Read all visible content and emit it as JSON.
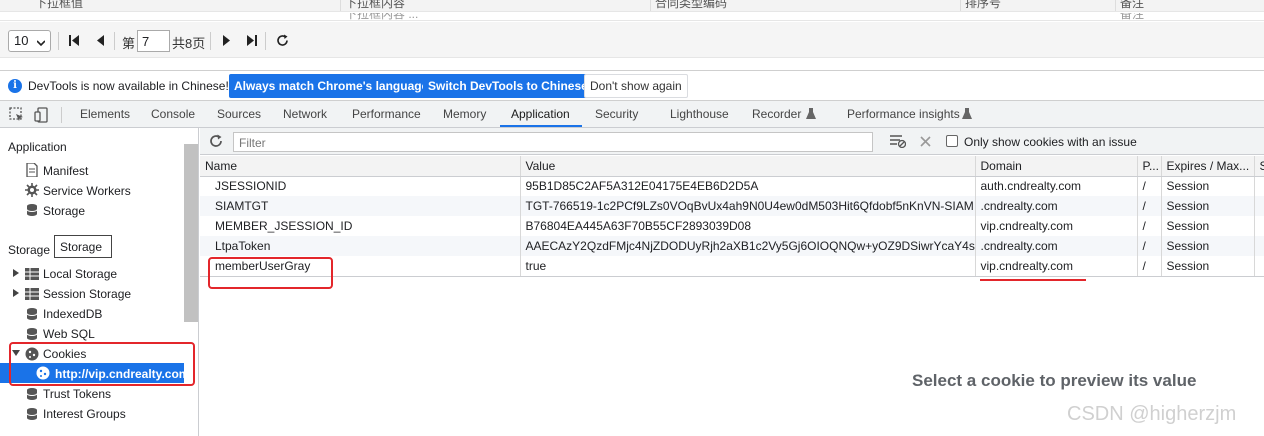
{
  "old_table": {
    "headers": [
      "下拉框值",
      "下拉框内容",
      "合同类型编码",
      "排序号",
      "备注"
    ],
    "row_fragment": [
      "下拉框内容 ...",
      "合同类型编码",
      "备注"
    ]
  },
  "pager": {
    "page_size": "10",
    "page_prefix": "第",
    "page_value": "7",
    "total_pages": "共8页"
  },
  "infobar": {
    "message": "DevTools is now available in Chinese!",
    "btn_match": "Always match Chrome's language",
    "btn_switch": "Switch DevTools to Chinese",
    "btn_dismiss": "Don't show again"
  },
  "tabs": [
    "Elements",
    "Console",
    "Sources",
    "Network",
    "Performance",
    "Memory",
    "Application",
    "Security",
    "Lighthouse",
    "Recorder",
    "Performance insights"
  ],
  "active_tab": "Application",
  "sidebar": {
    "application_heading": "Application",
    "application_items": [
      "Manifest",
      "Service Workers",
      "Storage"
    ],
    "storage_heading": "Storage",
    "tooltip": "Storage",
    "storage_items": [
      "Local Storage",
      "Session Storage",
      "IndexedDB",
      "Web SQL",
      "Cookies"
    ],
    "cookie_origin": "http://vip.cndrealty.com",
    "more_items": [
      "Trust Tokens",
      "Interest Groups"
    ]
  },
  "cookie_toolbar": {
    "filter_placeholder": "Filter",
    "only_issues_label": "Only show cookies with an issue"
  },
  "cookie_table": {
    "columns": [
      "Name",
      "Value",
      "Domain",
      "P...",
      "Expires / Max...",
      "S"
    ],
    "rows": [
      [
        "JSESSIONID",
        "95B1D85C2AF5A312E04175E4EB6D2D5A",
        "auth.cndrealty.com",
        "/",
        "Session"
      ],
      [
        "SIAMTGT",
        "TGT-766519-1c2PCf9LZs0VOqBvUx4ah9N0U4ew0dM503Hit6Qfdobf5nKnVN-SIAM",
        ".cndrealty.com",
        "/",
        "Session"
      ],
      [
        "MEMBER_JSESSION_ID",
        "B76804EA445A63F70B55CF2893039D08",
        "vip.cndrealty.com",
        "/",
        "Session"
      ],
      [
        "LtpaToken",
        "AAECAzY2QzdFMjc4NjZDODUyRjh2aXB1c2Vy5Gj6OIOQNQw+yOZ9DSiwrYcaY4s=",
        ".cndrealty.com",
        "/",
        "Session"
      ],
      [
        "memberUserGray",
        "true",
        "vip.cndrealty.com",
        "/",
        "Session"
      ]
    ]
  },
  "preview_message": "Select a cookie to preview its value",
  "watermark": "CSDN @higherzjm",
  "colors": {
    "accent": "#1a73e8",
    "highlight_red": "#e3262b"
  }
}
